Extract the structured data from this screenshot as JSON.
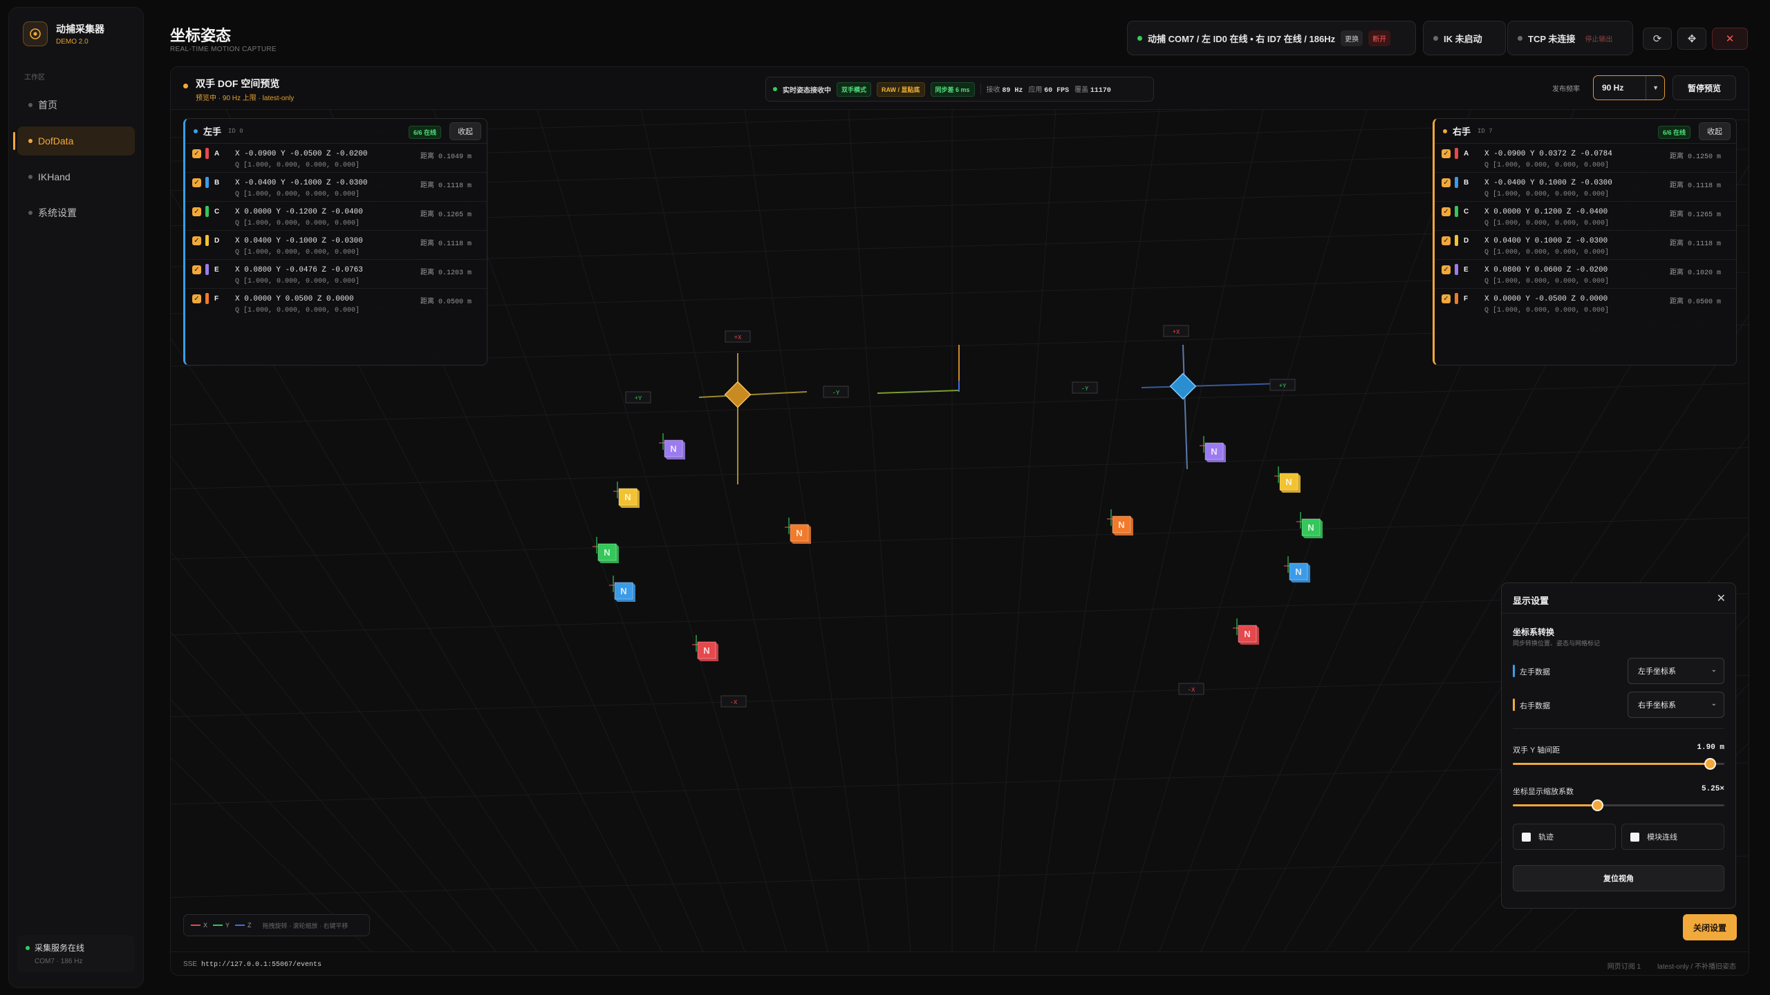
{
  "brand": {
    "title": "动捕采集器",
    "version": "DEMO 2.0"
  },
  "nav": {
    "section": "工作区",
    "items": [
      {
        "label": "首页"
      },
      {
        "label": "DofData"
      },
      {
        "label": "IKHand"
      },
      {
        "label": "系统设置"
      }
    ],
    "active": "DofData"
  },
  "service": {
    "status": "采集服务在线",
    "detail": "COM7 · 186 Hz"
  },
  "header": {
    "title": "坐标姿态",
    "subtitle": "REAL-TIME MOTION CAPTURE",
    "mocap": {
      "label": "动捕 COM7 / 左 ID0 在线 • 右 ID7 在线 / 186Hz",
      "swap": "更换",
      "disconnect": "断开",
      "color": "#30d05a"
    },
    "ik": {
      "label": "IK 未启动"
    },
    "tcp": {
      "label": "TCP 未连接",
      "action": "停止输出"
    },
    "buttons": {
      "refresh": "refresh-icon",
      "fullscreen": "crosshair-icon",
      "close": "close-icon"
    }
  },
  "preview": {
    "title": "双手 DOF 空间预览",
    "subtitle": "预览中 · 90 Hz 上限 · latest-only",
    "stream_status": "实时姿态接收中",
    "tags": [
      "双手模式",
      "RAW / 显贴底",
      "同步差 6 ms"
    ],
    "recv_label": "接收",
    "recv_value": "89 Hz",
    "apply_label": "应用",
    "apply_value": "60 FPS",
    "cover_label": "覆盖",
    "cover_value": "11170",
    "publish_label": "发布频率",
    "publish_value": "90 Hz",
    "pause": "暂停预览"
  },
  "left_hand": {
    "name": "左手",
    "id": "ID 0",
    "online": "6/6 在线",
    "fold": "收起",
    "accent": "#39a0e6",
    "rows": [
      {
        "label": "A",
        "color": "#e5484d",
        "xyz": "X -0.0900 Y -0.0500 Z -0.0200",
        "q": "Q [1.000, 0.000, 0.000, 0.000]",
        "dist": "距离 0.1049 m"
      },
      {
        "label": "B",
        "color": "#3b9be8",
        "xyz": "X -0.0400 Y -0.1000 Z -0.0300",
        "q": "Q [1.000, 0.000, 0.000, 0.000]",
        "dist": "距离 0.1118 m"
      },
      {
        "label": "C",
        "color": "#34c759",
        "xyz": "X 0.0000 Y -0.1200 Z -0.0400",
        "q": "Q [1.000, 0.000, 0.000, 0.000]",
        "dist": "距离 0.1265 m"
      },
      {
        "label": "D",
        "color": "#f2c230",
        "xyz": "X 0.0400 Y -0.1000 Z -0.0300",
        "q": "Q [1.000, 0.000, 0.000, 0.000]",
        "dist": "距离 0.1118 m"
      },
      {
        "label": "E",
        "color": "#9b7bf0",
        "xyz": "X 0.0800 Y -0.0476 Z -0.0763",
        "q": "Q [1.000, 0.000, 0.000, 0.000]",
        "dist": "距离 0.1203 m"
      },
      {
        "label": "F",
        "color": "#f27a2b",
        "xyz": "X 0.0000 Y 0.0500 Z 0.0000",
        "q": "Q [1.000, 0.000, 0.000, 0.000]",
        "dist": "距离 0.0500 m"
      }
    ]
  },
  "right_hand": {
    "name": "右手",
    "id": "ID 7",
    "online": "6/6 在线",
    "fold": "收起",
    "accent": "#f2a93b",
    "rows": [
      {
        "label": "A",
        "color": "#e5484d",
        "xyz": "X -0.0900 Y 0.0372 Z -0.0784",
        "q": "Q [1.000, 0.000, 0.000, 0.000]",
        "dist": "距离 0.1250 m"
      },
      {
        "label": "B",
        "color": "#3b9be8",
        "xyz": "X -0.0400 Y 0.1000 Z -0.0300",
        "q": "Q [1.000, 0.000, 0.000, 0.000]",
        "dist": "距离 0.1118 m"
      },
      {
        "label": "C",
        "color": "#34c759",
        "xyz": "X 0.0000 Y 0.1200 Z -0.0400",
        "q": "Q [1.000, 0.000, 0.000, 0.000]",
        "dist": "距离 0.1265 m"
      },
      {
        "label": "D",
        "color": "#f2c230",
        "xyz": "X 0.0400 Y 0.1000 Z -0.0300",
        "q": "Q [1.000, 0.000, 0.000, 0.000]",
        "dist": "距离 0.1118 m"
      },
      {
        "label": "E",
        "color": "#9b7bf0",
        "xyz": "X 0.0800 Y 0.0600 Z -0.0200",
        "q": "Q [1.000, 0.000, 0.000, 0.000]",
        "dist": "距离 0.1020 m"
      },
      {
        "label": "F",
        "color": "#f27a2b",
        "xyz": "X 0.0000 Y -0.0500 Z 0.0000",
        "q": "Q [1.000, 0.000, 0.000, 0.000]",
        "dist": "距离 0.0500 m"
      }
    ]
  },
  "scene": {
    "left_marks": [
      "+X",
      "+Y",
      "-Y",
      "-X"
    ],
    "right_marks": [
      "+X",
      "-Y",
      "+Y",
      "-X"
    ],
    "module_letter": "N"
  },
  "legend": {
    "x": "X",
    "y": "Y",
    "z": "Z",
    "hint": "拖拽旋转 · 滚轮缩放 · 右键平移",
    "x_color": "#e5484d",
    "y_color": "#34c759",
    "z_color": "#3b6fe8"
  },
  "footer": {
    "protocol": "SSE",
    "url": "http://127.0.0.1:55067/events",
    "right1": "网页订阅 1",
    "right2": "latest-only / 不补播旧姿态"
  },
  "settings": {
    "title": "显示设置",
    "section": "坐标系转换",
    "section_sub": "同步转换位置、姿态与网格标记",
    "left_label": "左手数据",
    "left_value": "左手坐标系",
    "right_label": "右手数据",
    "right_value": "右手坐标系",
    "spacing_label": "双手 Y 轴间距",
    "spacing_value": "1.90 m",
    "spacing_fraction": 0.93,
    "scale_label": "坐标显示缩放系数",
    "scale_value": "5.25×",
    "scale_fraction": 0.4,
    "trail": "轨迹",
    "link": "模块连线",
    "reset": "复位视角",
    "close": "关闭设置"
  }
}
